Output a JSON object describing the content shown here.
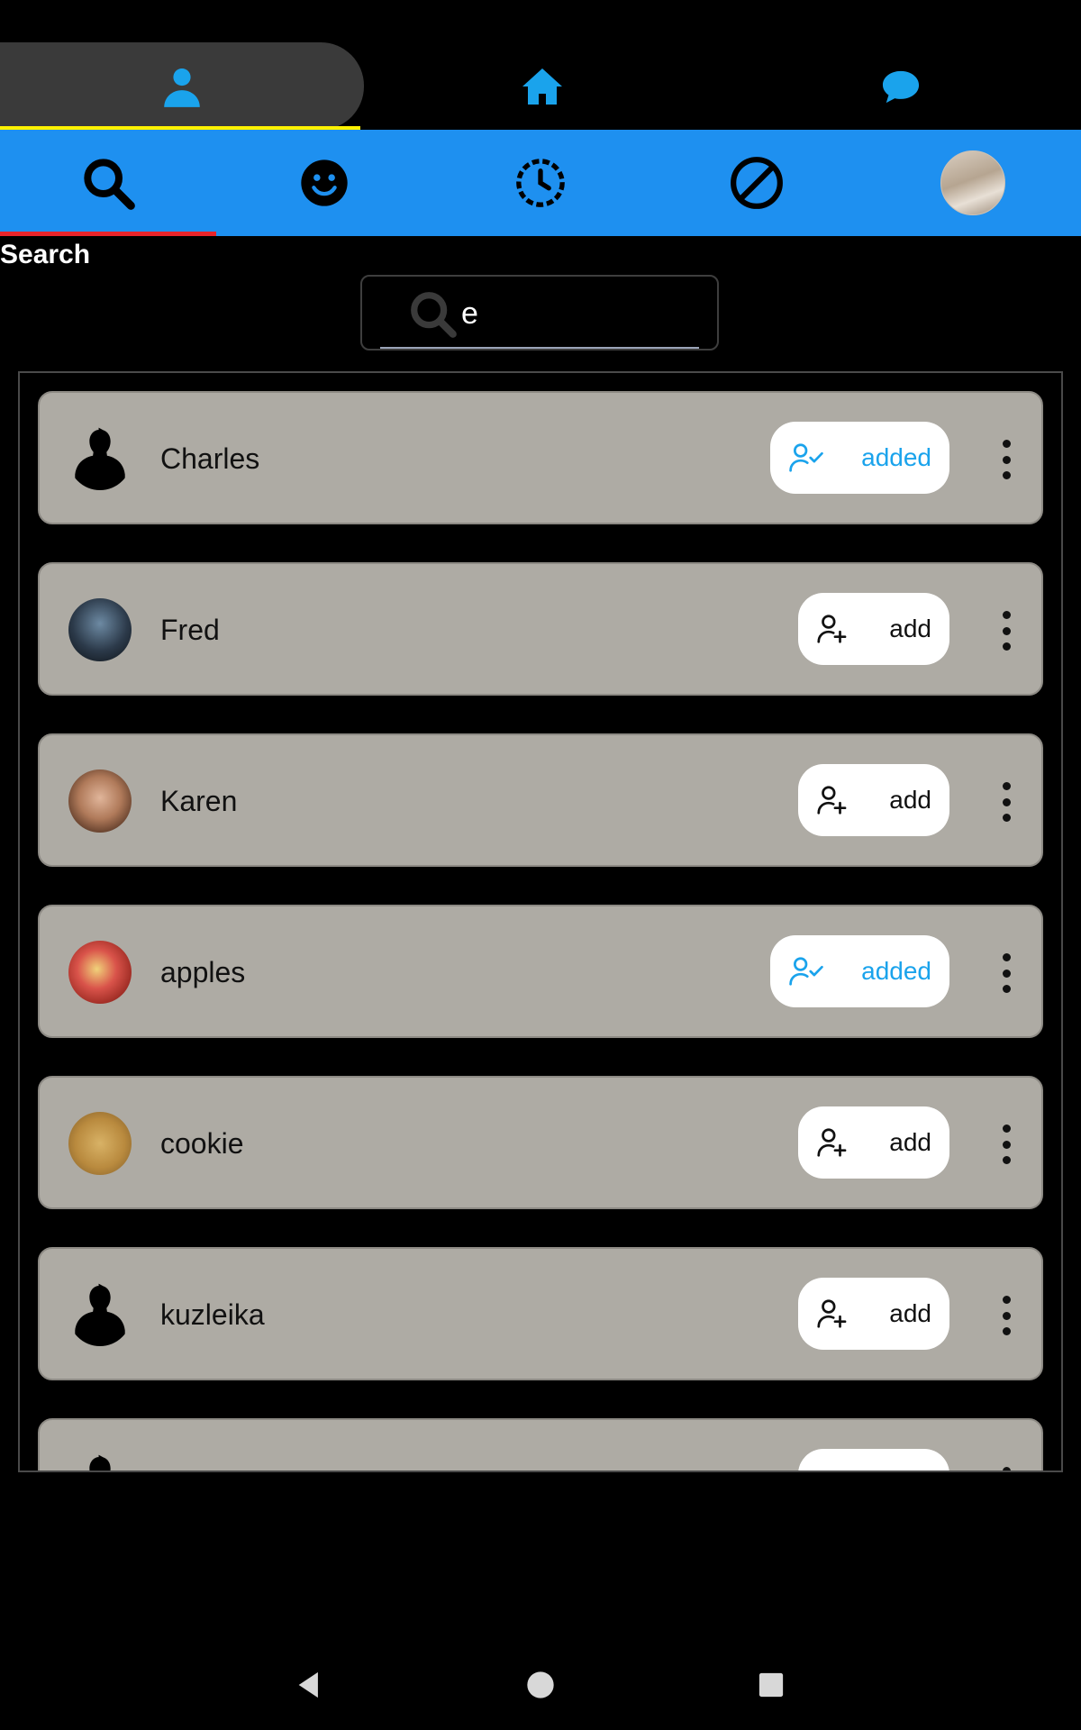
{
  "top_tabs": [
    {
      "id": "friends",
      "icon": "person-icon",
      "active": true
    },
    {
      "id": "home",
      "icon": "home-icon",
      "active": false
    },
    {
      "id": "chat",
      "icon": "chat-bubble-icon",
      "active": false
    }
  ],
  "toolbar": {
    "items": [
      "search-icon",
      "smiley-icon",
      "history-icon",
      "blocked-icon",
      "profile-avatar"
    ],
    "active_index": 0
  },
  "section": {
    "title": "Search"
  },
  "search": {
    "value": "e"
  },
  "results": [
    {
      "name": "Charles",
      "avatar": "silhouette",
      "status": "added",
      "button_label": "added"
    },
    {
      "name": "Fred",
      "avatar": "photo",
      "status": "add",
      "button_label": "add"
    },
    {
      "name": "Karen",
      "avatar": "photo",
      "status": "add",
      "button_label": "add"
    },
    {
      "name": "apples",
      "avatar": "photo",
      "status": "added",
      "button_label": "added"
    },
    {
      "name": "cookie",
      "avatar": "photo",
      "status": "add",
      "button_label": "add"
    },
    {
      "name": "kuzleika",
      "avatar": "silhouette",
      "status": "add",
      "button_label": "add"
    }
  ],
  "colors": {
    "accent_blue": "#1e90f0",
    "added_text": "#1aa3ec",
    "card_bg": "#aeaba4",
    "active_tab_underline": "#fff200",
    "toolbar_indicator": "#e8242a"
  },
  "system_nav": [
    "back-icon",
    "home-circle-icon",
    "recents-icon"
  ]
}
